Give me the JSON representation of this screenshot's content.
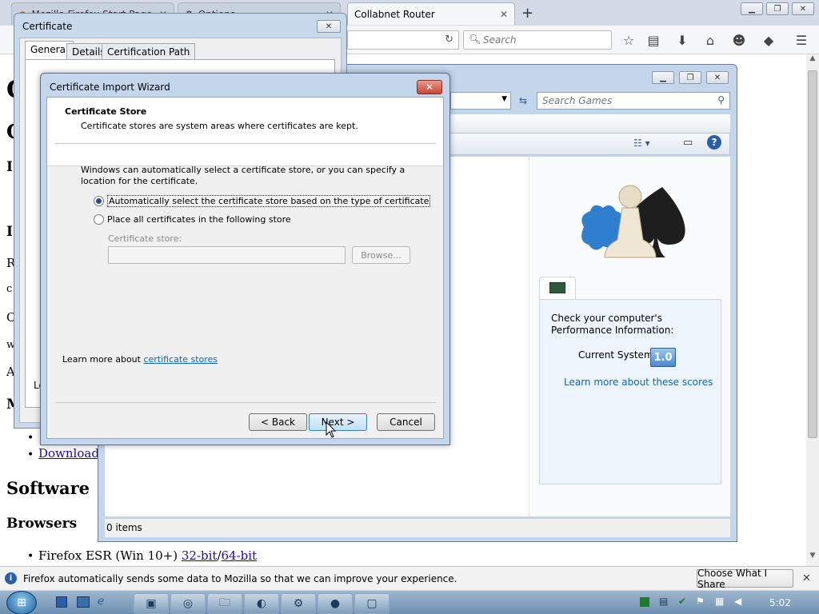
{
  "firefox": {
    "tabs": [
      {
        "title": "Mozilla Firefox Start Page"
      },
      {
        "title": "Options"
      },
      {
        "title": "Collabnet Router"
      }
    ],
    "search_placeholder": "Search"
  },
  "page": {
    "headings": {
      "software": "Software",
      "browsers": "Browsers"
    },
    "link_download": "Download C",
    "firefox_esr_prefix": "Firefox ESR (Win 10+) ",
    "link_32bit": "32-bit",
    "separator": "/",
    "link_64bit": "64-bit",
    "left_letters": [
      "C",
      "C",
      "I",
      "I",
      "R",
      "c",
      "C",
      "w",
      "A",
      "M"
    ]
  },
  "games_explorer": {
    "search_placeholder": "Search Games",
    "performance_text": "Check your computer's Performance Information:",
    "current_system_label": "Current System",
    "score": "1.0",
    "learn_more_link": "Learn more about these scores",
    "status_text": "0 items"
  },
  "certificate": {
    "title": "Certificate",
    "tabs": [
      "General",
      "Details",
      "Certification Path"
    ],
    "partial_text": "Le"
  },
  "wizard": {
    "title": "Certificate Import Wizard",
    "header_title": "Certificate Store",
    "header_desc": "Certificate stores are system areas where certificates are kept.",
    "intro": "Windows can automatically select a certificate store, or you can specify a location for the certificate.",
    "option_auto": "Automatically select the certificate store based on the type of certificate",
    "option_manual": "Place all certificates in the following store",
    "store_label": "Certificate store:",
    "store_value": "",
    "browse_label": "Browse...",
    "learn_prefix": "Learn more about ",
    "learn_link": "certificate stores",
    "back_label": "< Back",
    "next_label": "Next >",
    "cancel_label": "Cancel"
  },
  "notification": {
    "text": "Firefox automatically sends some data to Mozilla so that we can improve your experience.",
    "button_label": "Choose What I Share"
  },
  "taskbar": {
    "time": "5:02"
  },
  "colors": {
    "link": "#1a0dab",
    "wizard_link": "#0b65c2",
    "close_red": "#c8463a"
  }
}
